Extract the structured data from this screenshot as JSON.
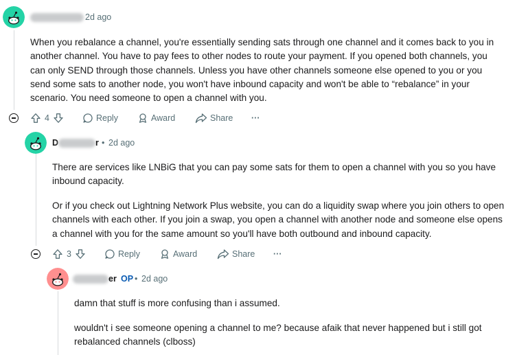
{
  "comments": [
    {
      "time": "2d ago",
      "paragraphs": [
        "When you rebalance a channel, you're essentially sending sats through one channel and it comes back to you in another channel. You have to pay fees to other nodes to route your payment. If you opened both channels, you can only SEND through those channels. Unless you have other channels someone else opened to you or you send some sats to another node, you won't have inbound capacity and won't be able to “rebalance” in your scenario. You need someone to open a channel with you."
      ],
      "votes": "4",
      "reply_label": "Reply",
      "award_label": "Award",
      "share_label": "Share",
      "more_label": "···",
      "avatar_color": "#24d3a6"
    },
    {
      "name_visible": "D",
      "name_suffix": "r",
      "time": "2d ago",
      "paragraphs": [
        "There are services like LNBiG that you can pay some sats for them to open a channel with you so you have inbound capacity.",
        "Or if you check out Lightning Network Plus website, you can do a liquidity swap where you join others to open channels with each other. If you join a swap, you open a channel with another node and someone else opens a channel with you for the same amount so you'll have both outbound and inbound capacity."
      ],
      "votes": "3",
      "reply_label": "Reply",
      "award_label": "Award",
      "share_label": "Share",
      "more_label": "···",
      "avatar_color": "#24d3a6"
    },
    {
      "name_suffix": "er",
      "op_label": "OP",
      "time": "2d ago",
      "paragraphs": [
        "damn that stuff is more confusing than i assumed.",
        "wouldn't i see someone opening a channel to me? because afaik that never happened but i still got rebalanced channels (clboss)"
      ],
      "avatar_color": "#ff8f8f"
    }
  ]
}
